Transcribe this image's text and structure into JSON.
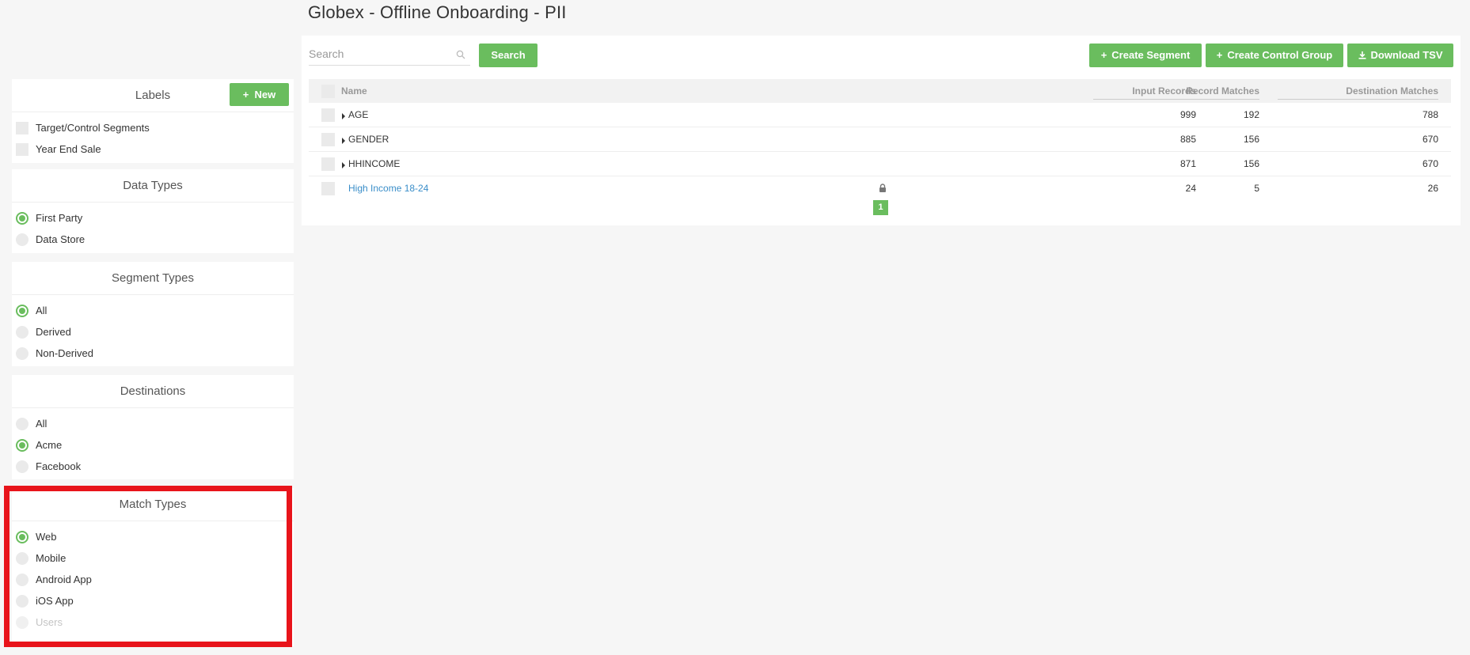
{
  "page_title": "Globex - Offline Onboarding - PII",
  "search": {
    "placeholder": "Search",
    "button_label": "Search"
  },
  "toolbar": {
    "create_segment": "Create Segment",
    "create_control_group": "Create Control Group",
    "download_tsv": "Download TSV"
  },
  "sidebar": {
    "labels": {
      "title": "Labels",
      "new_button": "New",
      "items": [
        "Target/Control Segments",
        "Year End Sale"
      ]
    },
    "data_types": {
      "title": "Data Types",
      "items": [
        {
          "label": "First Party",
          "selected": true
        },
        {
          "label": "Data Store",
          "selected": false
        }
      ]
    },
    "segment_types": {
      "title": "Segment Types",
      "items": [
        {
          "label": "All",
          "selected": true
        },
        {
          "label": "Derived",
          "selected": false
        },
        {
          "label": "Non-Derived",
          "selected": false
        }
      ]
    },
    "destinations": {
      "title": "Destinations",
      "items": [
        {
          "label": "All",
          "selected": false
        },
        {
          "label": "Acme",
          "selected": true
        },
        {
          "label": "Facebook",
          "selected": false
        }
      ]
    },
    "match_types": {
      "title": "Match Types",
      "items": [
        {
          "label": "Web",
          "selected": true
        },
        {
          "label": "Mobile",
          "selected": false
        },
        {
          "label": "Android App",
          "selected": false
        },
        {
          "label": "iOS App",
          "selected": false
        },
        {
          "label": "Users",
          "selected": false,
          "disabled": true
        }
      ]
    }
  },
  "table": {
    "columns": [
      "Name",
      "Input Records",
      "Record Matches",
      "Destination Matches"
    ],
    "rows": [
      {
        "name": "AGE",
        "input_records": "999",
        "record_matches": "192",
        "destination_matches": "788"
      },
      {
        "name": "GENDER",
        "input_records": "885",
        "record_matches": "156",
        "destination_matches": "670"
      },
      {
        "name": "HHINCOME",
        "input_records": "871",
        "record_matches": "156",
        "destination_matches": "670"
      },
      {
        "name": "High Income 18-24",
        "input_records": "24",
        "record_matches": "5",
        "destination_matches": "26"
      }
    ]
  },
  "pagination": {
    "current_page": "1"
  },
  "colors": {
    "accent": "#6abd5e",
    "link": "#3a8ec9",
    "highlight": "#e8141b"
  }
}
